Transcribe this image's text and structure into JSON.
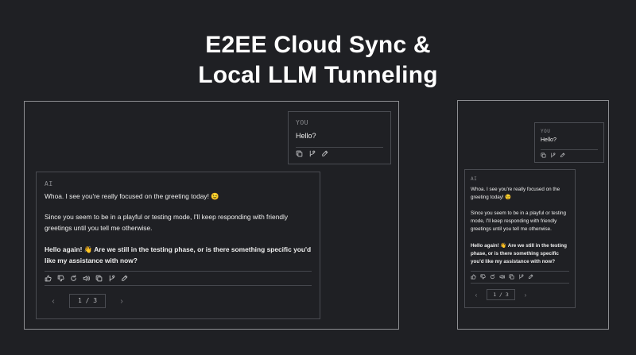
{
  "hero": {
    "title_line1": "E2EE Cloud Sync &",
    "title_line2": "Local LLM Tunneling"
  },
  "chat": {
    "user": {
      "role": "YOU",
      "message": "Hello?"
    },
    "ai": {
      "role": "AI",
      "paragraphs": [
        "Whoa. I see you're really focused on the greeting today! 😉",
        "Since you seem to be in a playful or testing mode, I'll keep responding with friendly greetings until you tell me otherwise.",
        "Hello again! 👋 Are we still in the testing phase, or is there something specific you'd like my assistance with now?"
      ]
    },
    "pager": {
      "label": "1 / 3",
      "prev": "‹",
      "next": "›"
    }
  },
  "icons": {
    "user_actions": [
      "copy-icon",
      "branch-icon",
      "edit-icon"
    ],
    "ai_actions": [
      "thumbs-up-icon",
      "thumbs-down-icon",
      "regenerate-icon",
      "speaker-icon",
      "copy-icon",
      "branch-icon",
      "edit-icon"
    ]
  },
  "colors": {
    "background": "#1f2024",
    "frame": "#8d8e92",
    "card_border": "#4a4c52",
    "text": "#eeeeee",
    "muted": "#8b8c90"
  }
}
